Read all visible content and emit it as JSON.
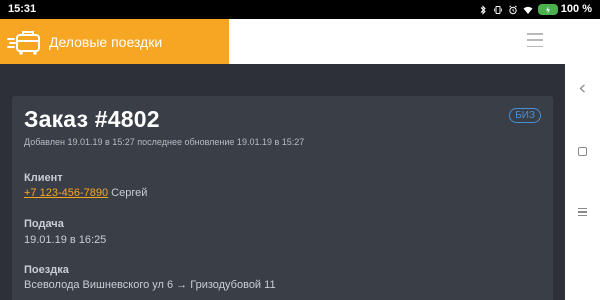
{
  "status_bar": {
    "time": "15:31",
    "battery_percent": "100 %",
    "icons": [
      "bluetooth-icon",
      "vibrate-icon",
      "alarm-icon",
      "wifi-icon",
      "battery-icon"
    ]
  },
  "app": {
    "title": "Деловые поездки",
    "brand_color": "#f6a623",
    "background_color": "#2d3037"
  },
  "order": {
    "title": "Заказ #4802",
    "badge": "БИЗ",
    "meta": "Добавлен 19.01.19 в 15:27 последнее обновление 19.01.19 в 15:27",
    "client_label": "Клиент",
    "client_phone": "+7 123-456-7890",
    "client_name": "Сергей",
    "pickup_label": "Подача",
    "pickup_value": "19.01.19 в 16:25",
    "trip_label": "Поездка",
    "trip_value": "Всеволода Вишневского ул 6 → Гризодубовой 11"
  },
  "navbar": {
    "icons": [
      "back-icon",
      "home-icon",
      "menu-icon"
    ]
  }
}
